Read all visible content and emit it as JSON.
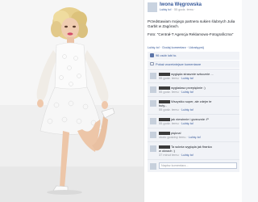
{
  "post": {
    "page_name": "Iwona Węgrowska",
    "meta_like": "Lubię to!",
    "meta_time": "· 55 godz. temu ·",
    "caption_line1": "Przedstawiam mojego partnera sukien ślubnych Julia Garbit w Zagórach.",
    "caption_line2": "Foto: \"Centrał-T Agencja Reklamowo-Fotograficzna\"",
    "actions": "Lubię to! · Dodaj komentarz · Udostępnij",
    "likes": "96 osób lubi to.",
    "view_previous": "Pokaż wcześniejsze komentarze"
  },
  "comments": [
    {
      "text": "wygląda strasznie sztucznie ...",
      "meta": "55 godz. temu ·",
      "like": "Lubię to!"
    },
    {
      "text": "wygladasz przepięknie :)",
      "meta": "55 godz. temu ·",
      "like": "Lubię to!"
    },
    {
      "text": "Wszystko super, ale zdejm te",
      "text2": "buty...",
      "meta": "55 godz. temu ·",
      "like": "Lubię to!"
    },
    {
      "text": "jak niewinnie i grzecznie :P",
      "meta": "55 godz. temu ·",
      "like": "Lubię to!"
    },
    {
      "text": "piękna!",
      "meta": "około godziny temu ·",
      "like": "Lubię to!"
    },
    {
      "text": "Ta suknia wygląda jak firanka",
      "text2": "w oknach :)",
      "meta": "37 minut temu ·",
      "like": "Lubię to!"
    }
  ],
  "reply_placeholder": "Napisz komentarz..."
}
